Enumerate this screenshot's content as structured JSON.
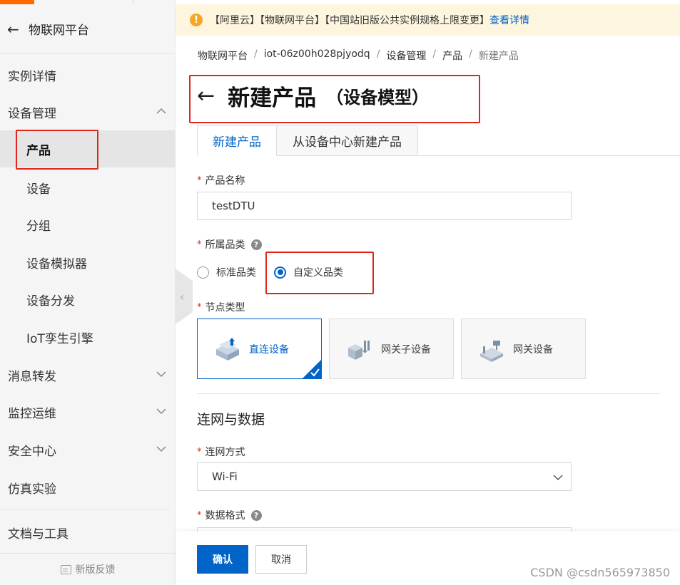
{
  "sidebar": {
    "title": "物联网平台",
    "items": [
      {
        "label": "实例详情"
      },
      {
        "label": "设备管理"
      },
      {
        "label": "产品"
      },
      {
        "label": "设备"
      },
      {
        "label": "分组"
      },
      {
        "label": "设备模拟器"
      },
      {
        "label": "设备分发"
      },
      {
        "label": "IoT孪生引擎"
      },
      {
        "label": "消息转发"
      },
      {
        "label": "监控运维"
      },
      {
        "label": "安全中心"
      },
      {
        "label": "仿真实验"
      },
      {
        "label": "文档与工具"
      }
    ],
    "feedback": "新版反馈"
  },
  "notice": {
    "text": "【阿里云】【物联网平台】【中国站旧版公共实例规格上限变更】",
    "link": "查看详情"
  },
  "breadcrumb": [
    "物联网平台",
    "iot-06z00h028pjyodq",
    "设备管理",
    "产品",
    "新建产品"
  ],
  "page": {
    "title": "新建产品",
    "subtitle": "（设备模型）"
  },
  "tabs": [
    "新建产品",
    "从设备中心新建产品"
  ],
  "form": {
    "product_name": {
      "label": "产品名称",
      "value": "testDTU"
    },
    "category": {
      "label": "所属品类",
      "options": [
        "标准品类",
        "自定义品类"
      ],
      "selected": "自定义品类"
    },
    "node_type": {
      "label": "节点类型",
      "options": [
        "直连设备",
        "网关子设备",
        "网关设备"
      ],
      "selected": "直连设备"
    },
    "section_title": "连网与数据",
    "network": {
      "label": "连网方式",
      "value": "Wi-Fi"
    },
    "data_format": {
      "label": "数据格式"
    }
  },
  "footer": {
    "confirm": "确认",
    "cancel": "取消",
    "watermark": "CSDN @csdn565973850"
  },
  "colors": {
    "accent": "#0064c8",
    "brand": "#ff6a00",
    "annotation": "#e1251b"
  }
}
